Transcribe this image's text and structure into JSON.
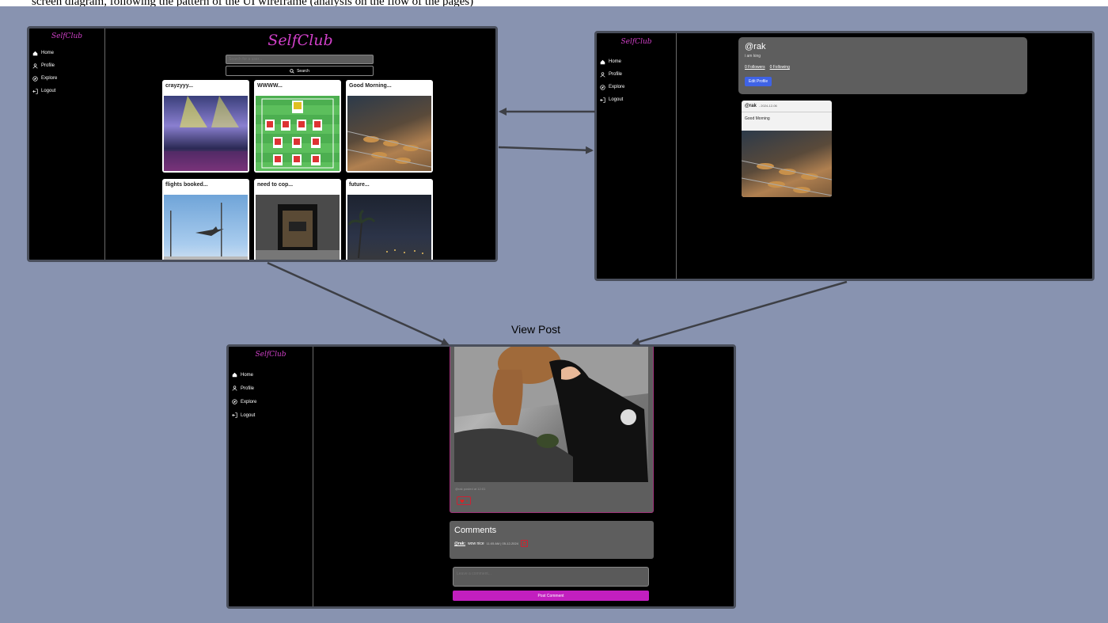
{
  "top_text": "screen diagram, following the pattern of the UI wireframe (analysis on the flow of the pages)",
  "section_label": "View Post",
  "colors": {
    "brand": "#d040c8",
    "accent_blue": "#3f63e6",
    "accent_pink": "#c21fbf",
    "background": "#8893b0"
  },
  "nav": {
    "brand": "SelfClub",
    "items": [
      {
        "label": "Home",
        "icon": "home-icon"
      },
      {
        "label": "Profile",
        "icon": "user-icon"
      },
      {
        "label": "Explore",
        "icon": "compass-icon"
      },
      {
        "label": "Logout",
        "icon": "logout-icon"
      }
    ]
  },
  "home": {
    "title": "SelfClub",
    "search_placeholder": "Search for a user...",
    "search_button": "Search",
    "posts": [
      {
        "title": "crayzyyy..."
      },
      {
        "title": "WWWW..."
      },
      {
        "title": "Good Morning..."
      },
      {
        "title": "flights booked..."
      },
      {
        "title": "need to cop..."
      },
      {
        "title": "future..."
      }
    ]
  },
  "profile": {
    "handle": "@rak",
    "bio": "i am king",
    "followers": "0 Followers",
    "following": "0 Following",
    "edit_button": "Edit Profile",
    "post": {
      "author": "@rak",
      "date": "- 2024-12-06",
      "caption": "Good Morning"
    }
  },
  "view_post": {
    "meta": "@rak posted at 12:01",
    "like_label": "0",
    "comments_heading": "Comments",
    "comment": {
      "author": "@rak:",
      "text": "wow nice",
      "timestamp": "11:05 AM | 05-12-2024"
    },
    "comment_placeholder": "Leave a comment...",
    "post_button": "Post Comment"
  }
}
